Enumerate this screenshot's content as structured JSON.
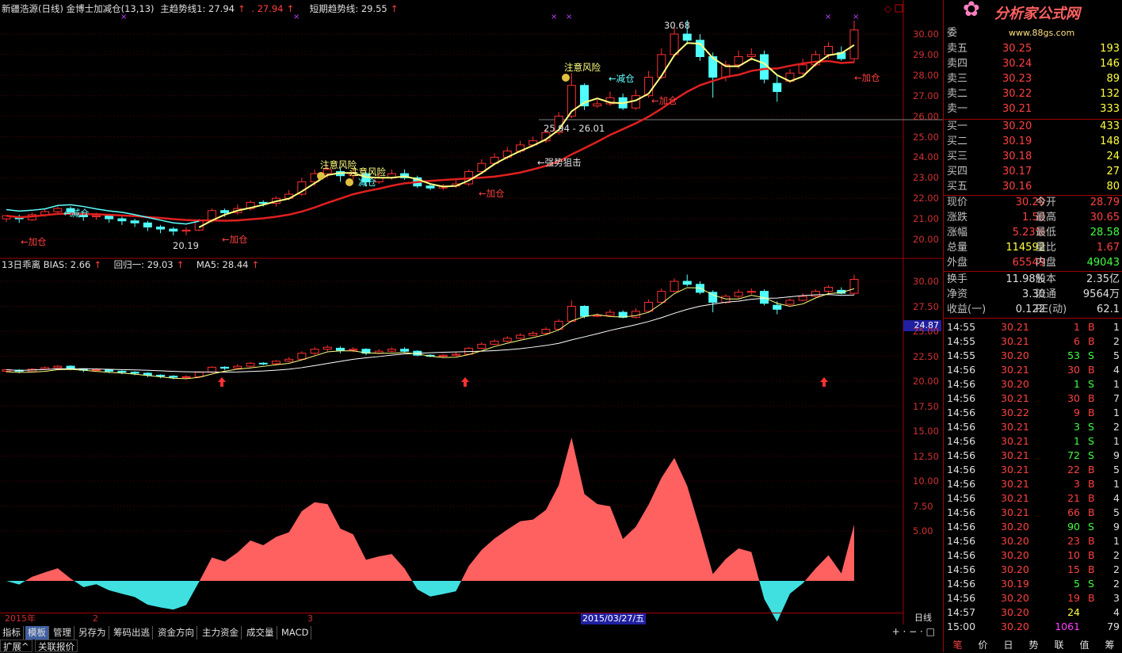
{
  "header": {
    "title": "新疆浩源(日线) 金博士加减仓(13,13)",
    "main_trend_label": "主趋势线1: 27.94",
    "main_trend_val2": ". 27.94",
    "short_trend_label": "短期趋势线: 29.55"
  },
  "indicator_header": {
    "bias_label": "13日乖离  BIAS: 2.66",
    "regress_label": "回归一: 29.03",
    "ma5_label": "MA5: 28.44"
  },
  "y_axis_top": [
    "30.00",
    "29.00",
    "28.00",
    "27.00",
    "26.00",
    "25.00",
    "24.00",
    "23.00",
    "22.00",
    "21.00",
    "20.00"
  ],
  "y_axis_mid": [
    "30.00",
    "27.50",
    "25.00",
    "22.50",
    "20.00",
    "17.50",
    "15.00",
    "12.50",
    "10.00",
    "7.50",
    "5.00"
  ],
  "current_marker": "24.87",
  "annotations": {
    "hi": "30.68",
    "lo": "20.19",
    "range": "25.94 - 26.01",
    "risk1": "注意风险",
    "risk2": "注意风险",
    "risk3": "注意风险",
    "reduce1": "←减仓",
    "reduce2": "减仓",
    "reduce3": "←减仓",
    "add1": "←加仓",
    "add2": "←加仓",
    "add3": "←加仓",
    "add4": "←加仓",
    "add5": "←加仓",
    "strong": "←强势狙击"
  },
  "x_axis": {
    "year": "2015年",
    "m2": "2",
    "m3": "3",
    "cursor_date": "2015/03/27/五",
    "period": "日线"
  },
  "tabs": [
    "指标",
    "模板",
    "管理",
    "另存为",
    "筹码出逃",
    "资金方向",
    "主力资金",
    "成交量",
    "MACD"
  ],
  "selected_tab": "模板",
  "bottom_tabs": [
    "扩展^",
    "关联报价"
  ],
  "side_bottom_tabs": [
    "笔",
    "价",
    "日",
    "势",
    "联",
    "值",
    "筹"
  ],
  "logo": {
    "title": "分析家公式网",
    "url": "www.88gs.com"
  },
  "order_book": {
    "header": "委",
    "sells": [
      {
        "label": "卖五",
        "price": "30.25",
        "vol": "193"
      },
      {
        "label": "卖四",
        "price": "30.24",
        "vol": "146"
      },
      {
        "label": "卖三",
        "price": "30.23",
        "vol": "89"
      },
      {
        "label": "卖二",
        "price": "30.22",
        "vol": "132"
      },
      {
        "label": "卖一",
        "price": "30.21",
        "vol": "333"
      }
    ],
    "buys": [
      {
        "label": "买一",
        "price": "30.20",
        "vol": "433"
      },
      {
        "label": "买二",
        "price": "30.19",
        "vol": "148"
      },
      {
        "label": "买三",
        "price": "30.18",
        "vol": "24"
      },
      {
        "label": "买四",
        "price": "30.17",
        "vol": "27"
      },
      {
        "label": "买五",
        "price": "30.16",
        "vol": "80"
      }
    ]
  },
  "stats": [
    {
      "l1": "现价",
      "v1": "30.20",
      "l2": "今开",
      "v2": "28.79",
      "c1": "#ff4040",
      "c2": "#ff4040"
    },
    {
      "l1": "涨跌",
      "v1": "1.50",
      "l2": "最高",
      "v2": "30.65",
      "c1": "#ff4040",
      "c2": "#ff4040"
    },
    {
      "l1": "涨幅",
      "v1": "5.23%",
      "l2": "最低",
      "v2": "28.58",
      "c1": "#ff4040",
      "c2": "#40ff40"
    },
    {
      "l1": "总量",
      "v1": "114592",
      "l2": "量比",
      "v2": "1.67",
      "c1": "#ffff40",
      "c2": "#ff4040"
    },
    {
      "l1": "外盘",
      "v1": "65549",
      "l2": "内盘",
      "v2": "49043",
      "c1": "#ff4040",
      "c2": "#40ff40"
    }
  ],
  "stats2": [
    {
      "l1": "换手",
      "v1": "11.98%",
      "l2": "股本",
      "v2": "2.35亿"
    },
    {
      "l1": "净资",
      "v1": "3.30",
      "l2": "流通",
      "v2": "9564万"
    },
    {
      "l1": "收益(一)",
      "v1": "0.122",
      "l2": "PE(动)",
      "v2": "62.1"
    }
  ],
  "ticks": [
    {
      "t": "14:55",
      "p": "30.21",
      "v": "1",
      "s": "B",
      "n": "1"
    },
    {
      "t": "14:55",
      "p": "30.21",
      "v": "6",
      "s": "B",
      "n": "2"
    },
    {
      "t": "14:55",
      "p": "30.20",
      "v": "53",
      "s": "S",
      "n": "5"
    },
    {
      "t": "14:56",
      "p": "30.21",
      "v": "30",
      "s": "B",
      "n": "4"
    },
    {
      "t": "14:56",
      "p": "30.20",
      "v": "1",
      "s": "S",
      "n": "1"
    },
    {
      "t": "14:56",
      "p": "30.21",
      "v": "30",
      "s": "B",
      "n": "7"
    },
    {
      "t": "14:56",
      "p": "30.22",
      "v": "9",
      "s": "B",
      "n": "1"
    },
    {
      "t": "14:56",
      "p": "30.21",
      "v": "3",
      "s": "S",
      "n": "2"
    },
    {
      "t": "14:56",
      "p": "30.21",
      "v": "1",
      "s": "S",
      "n": "1"
    },
    {
      "t": "14:56",
      "p": "30.21",
      "v": "72",
      "s": "S",
      "n": "9"
    },
    {
      "t": "14:56",
      "p": "30.21",
      "v": "22",
      "s": "B",
      "n": "5"
    },
    {
      "t": "14:56",
      "p": "30.21",
      "v": "3",
      "s": "B",
      "n": "1"
    },
    {
      "t": "14:56",
      "p": "30.21",
      "v": "21",
      "s": "B",
      "n": "4"
    },
    {
      "t": "14:56",
      "p": "30.21",
      "v": "66",
      "s": "B",
      "n": "5"
    },
    {
      "t": "14:56",
      "p": "30.20",
      "v": "90",
      "s": "S",
      "n": "9"
    },
    {
      "t": "14:56",
      "p": "30.20",
      "v": "23",
      "s": "B",
      "n": "1"
    },
    {
      "t": "14:56",
      "p": "30.20",
      "v": "10",
      "s": "B",
      "n": "2"
    },
    {
      "t": "14:56",
      "p": "30.20",
      "v": "15",
      "s": "B",
      "n": "2"
    },
    {
      "t": "14:56",
      "p": "30.19",
      "v": "5",
      "s": "S",
      "n": "2"
    },
    {
      "t": "14:56",
      "p": "30.20",
      "v": "19",
      "s": "B",
      "n": "3"
    },
    {
      "t": "14:57",
      "p": "30.20",
      "v": "24",
      "s": "",
      "n": "4"
    },
    {
      "t": "15:00",
      "p": "30.20",
      "v": "1061",
      "s": "",
      "n": "79"
    }
  ],
  "candles": [
    [
      21.0,
      21.15,
      20.85,
      21.1
    ],
    [
      21.1,
      21.0,
      20.8,
      21.2
    ],
    [
      20.95,
      21.2,
      20.9,
      21.3
    ],
    [
      21.2,
      21.35,
      21.1,
      21.5
    ],
    [
      21.35,
      21.5,
      21.2,
      21.6
    ],
    [
      21.5,
      21.3,
      21.1,
      21.6
    ],
    [
      21.25,
      21.1,
      20.9,
      21.3
    ],
    [
      21.1,
      21.15,
      20.95,
      21.3
    ],
    [
      21.15,
      21.0,
      20.8,
      21.2
    ],
    [
      21.0,
      20.9,
      20.7,
      21.1
    ],
    [
      20.9,
      20.8,
      20.6,
      21.0
    ],
    [
      20.8,
      20.6,
      20.4,
      20.9
    ],
    [
      20.6,
      20.5,
      20.3,
      20.7
    ],
    [
      20.5,
      20.4,
      20.19,
      20.6
    ],
    [
      20.4,
      20.45,
      20.2,
      20.6
    ],
    [
      20.45,
      20.9,
      20.4,
      21.0
    ],
    [
      20.9,
      21.4,
      20.8,
      21.5
    ],
    [
      21.4,
      21.3,
      21.1,
      21.5
    ],
    [
      21.3,
      21.5,
      21.2,
      21.7
    ],
    [
      21.5,
      21.8,
      21.4,
      21.9
    ],
    [
      21.8,
      21.75,
      21.6,
      21.9
    ],
    [
      21.75,
      22.0,
      21.6,
      22.1
    ],
    [
      22.0,
      22.2,
      21.9,
      22.4
    ],
    [
      22.2,
      22.8,
      22.1,
      23.0
    ],
    [
      22.8,
      23.2,
      22.6,
      23.4
    ],
    [
      23.2,
      23.4,
      23.0,
      23.6
    ],
    [
      23.3,
      23.1,
      22.8,
      23.5
    ],
    [
      23.1,
      23.2,
      22.9,
      23.4
    ],
    [
      23.2,
      22.8,
      22.6,
      23.3
    ],
    [
      22.8,
      23.0,
      22.7,
      23.2
    ],
    [
      23.0,
      23.2,
      22.9,
      23.4
    ],
    [
      23.2,
      23.0,
      22.9,
      23.4
    ],
    [
      23.0,
      22.6,
      22.5,
      23.1
    ],
    [
      22.6,
      22.5,
      22.4,
      22.7
    ],
    [
      22.5,
      22.6,
      22.4,
      22.7
    ],
    [
      22.6,
      22.7,
      22.5,
      22.9
    ],
    [
      22.7,
      23.3,
      22.6,
      23.4
    ],
    [
      23.3,
      23.7,
      23.2,
      23.9
    ],
    [
      23.7,
      24.0,
      23.6,
      24.2
    ],
    [
      24.0,
      24.3,
      23.9,
      24.5
    ],
    [
      24.3,
      24.6,
      24.2,
      24.8
    ],
    [
      24.6,
      24.8,
      24.5,
      25.0
    ],
    [
      24.8,
      25.2,
      24.7,
      25.4
    ],
    [
      25.2,
      26.0,
      25.1,
      26.2
    ],
    [
      26.0,
      27.5,
      25.9,
      28.1
    ],
    [
      27.5,
      26.5,
      26.3,
      27.6
    ],
    [
      26.5,
      26.6,
      26.4,
      26.8
    ],
    [
      26.6,
      26.9,
      26.5,
      27.2
    ],
    [
      26.9,
      26.4,
      26.3,
      27.1
    ],
    [
      26.4,
      27.0,
      26.3,
      27.3
    ],
    [
      27.0,
      27.9,
      26.9,
      28.2
    ],
    [
      27.9,
      29.0,
      27.8,
      29.3
    ],
    [
      29.0,
      30.0,
      28.9,
      30.3
    ],
    [
      30.0,
      29.7,
      29.5,
      30.68
    ],
    [
      29.7,
      28.9,
      28.7,
      30.0
    ],
    [
      28.9,
      27.9,
      26.9,
      29.1
    ],
    [
      27.9,
      28.5,
      27.7,
      28.7
    ],
    [
      28.5,
      28.9,
      28.3,
      29.2
    ],
    [
      28.9,
      29.0,
      28.7,
      29.3
    ],
    [
      29.0,
      27.8,
      27.6,
      29.2
    ],
    [
      27.6,
      27.2,
      26.7,
      28.0
    ],
    [
      27.7,
      28.1,
      27.6,
      28.3
    ],
    [
      28.1,
      28.5,
      28.0,
      28.8
    ],
    [
      28.5,
      29.0,
      28.4,
      29.2
    ],
    [
      29.0,
      29.4,
      28.8,
      29.6
    ],
    [
      29.1,
      28.8,
      28.7,
      29.4
    ],
    [
      28.8,
      30.2,
      28.6,
      30.65
    ]
  ]
}
